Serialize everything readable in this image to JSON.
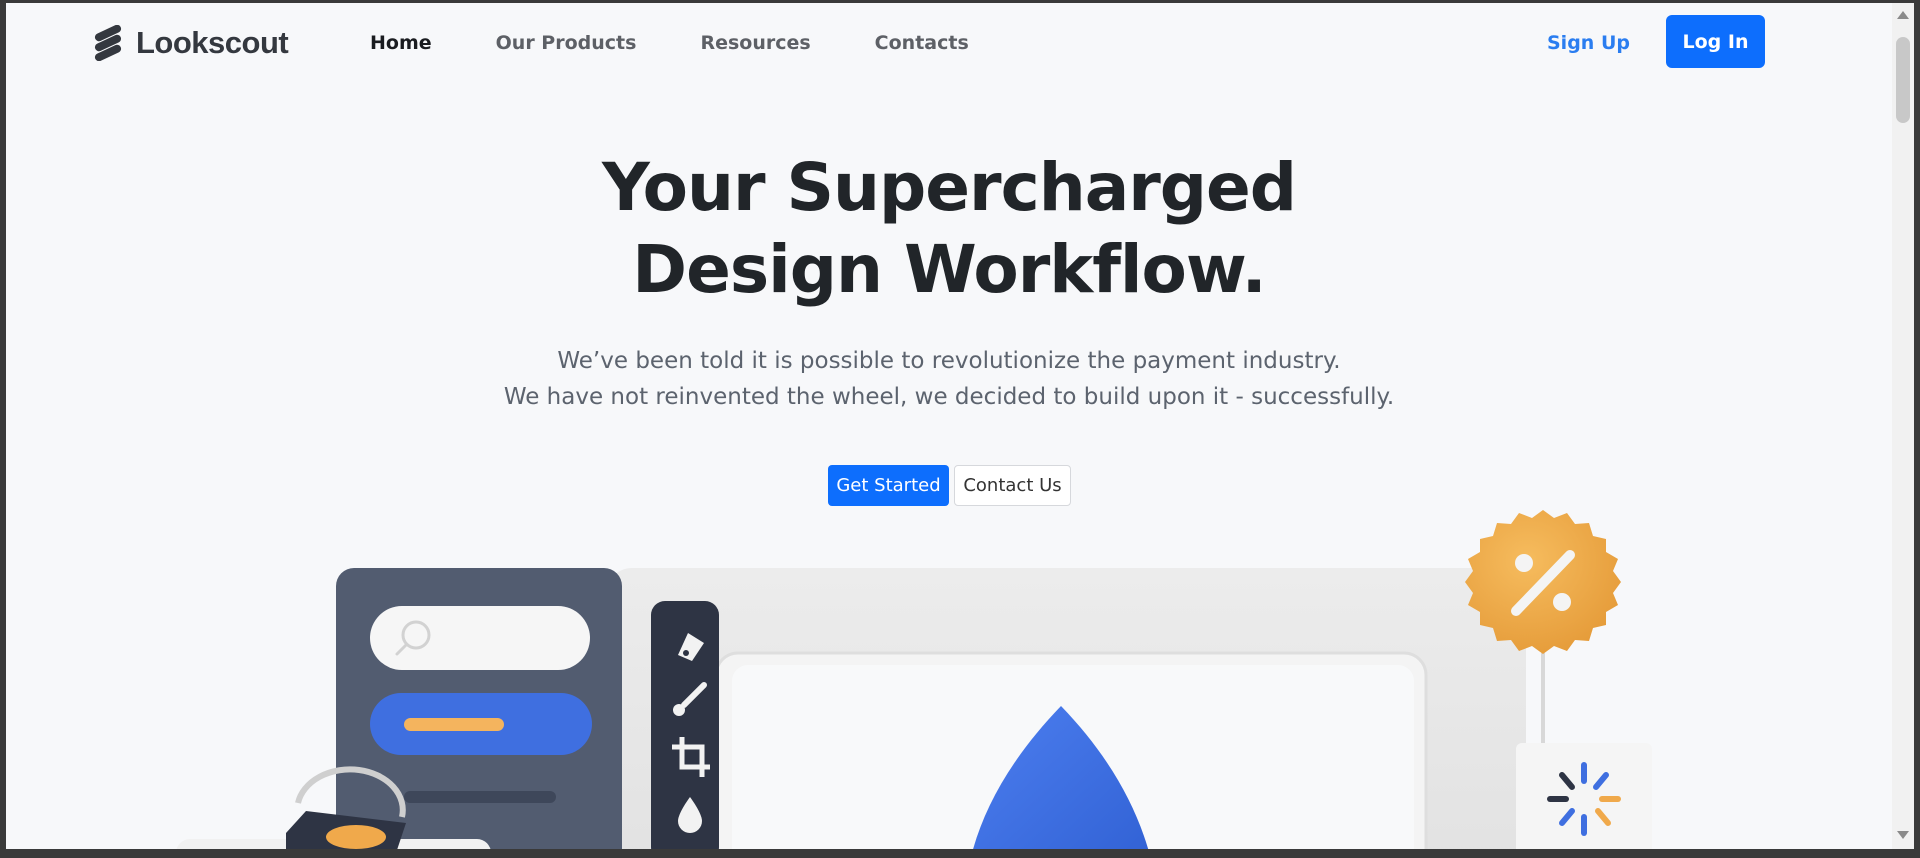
{
  "brand": {
    "name": "Lookscout"
  },
  "nav": {
    "links": [
      {
        "label": "Home",
        "active": true
      },
      {
        "label": "Our Products",
        "active": false
      },
      {
        "label": "Resources",
        "active": false
      },
      {
        "label": "Contacts",
        "active": false
      }
    ],
    "signup_label": "Sign Up",
    "login_label": "Log In"
  },
  "hero": {
    "title_line1": "Your Supercharged",
    "title_line2": "Design Workflow.",
    "subtitle_line1": "We’ve been told it is possible to revolutionize the payment industry.",
    "subtitle_line2": "We have not reinvented the wheel, we decided to build upon it - successfully.",
    "primary_button": "Get Started",
    "secondary_button": "Contact Us"
  },
  "colors": {
    "accent": "#0d6efd",
    "link": "#2a7df0",
    "heading": "#212529",
    "body_text": "#5c636e",
    "panel": "#525c70",
    "badge": "#f0a94b",
    "drop": "#3f6fe0"
  },
  "illustration": {
    "icons": [
      "search-icon",
      "pen-tool-icon",
      "brush-icon",
      "crop-icon",
      "drop-icon",
      "percent-icon",
      "loader-icon",
      "paint-bucket-icon"
    ]
  }
}
